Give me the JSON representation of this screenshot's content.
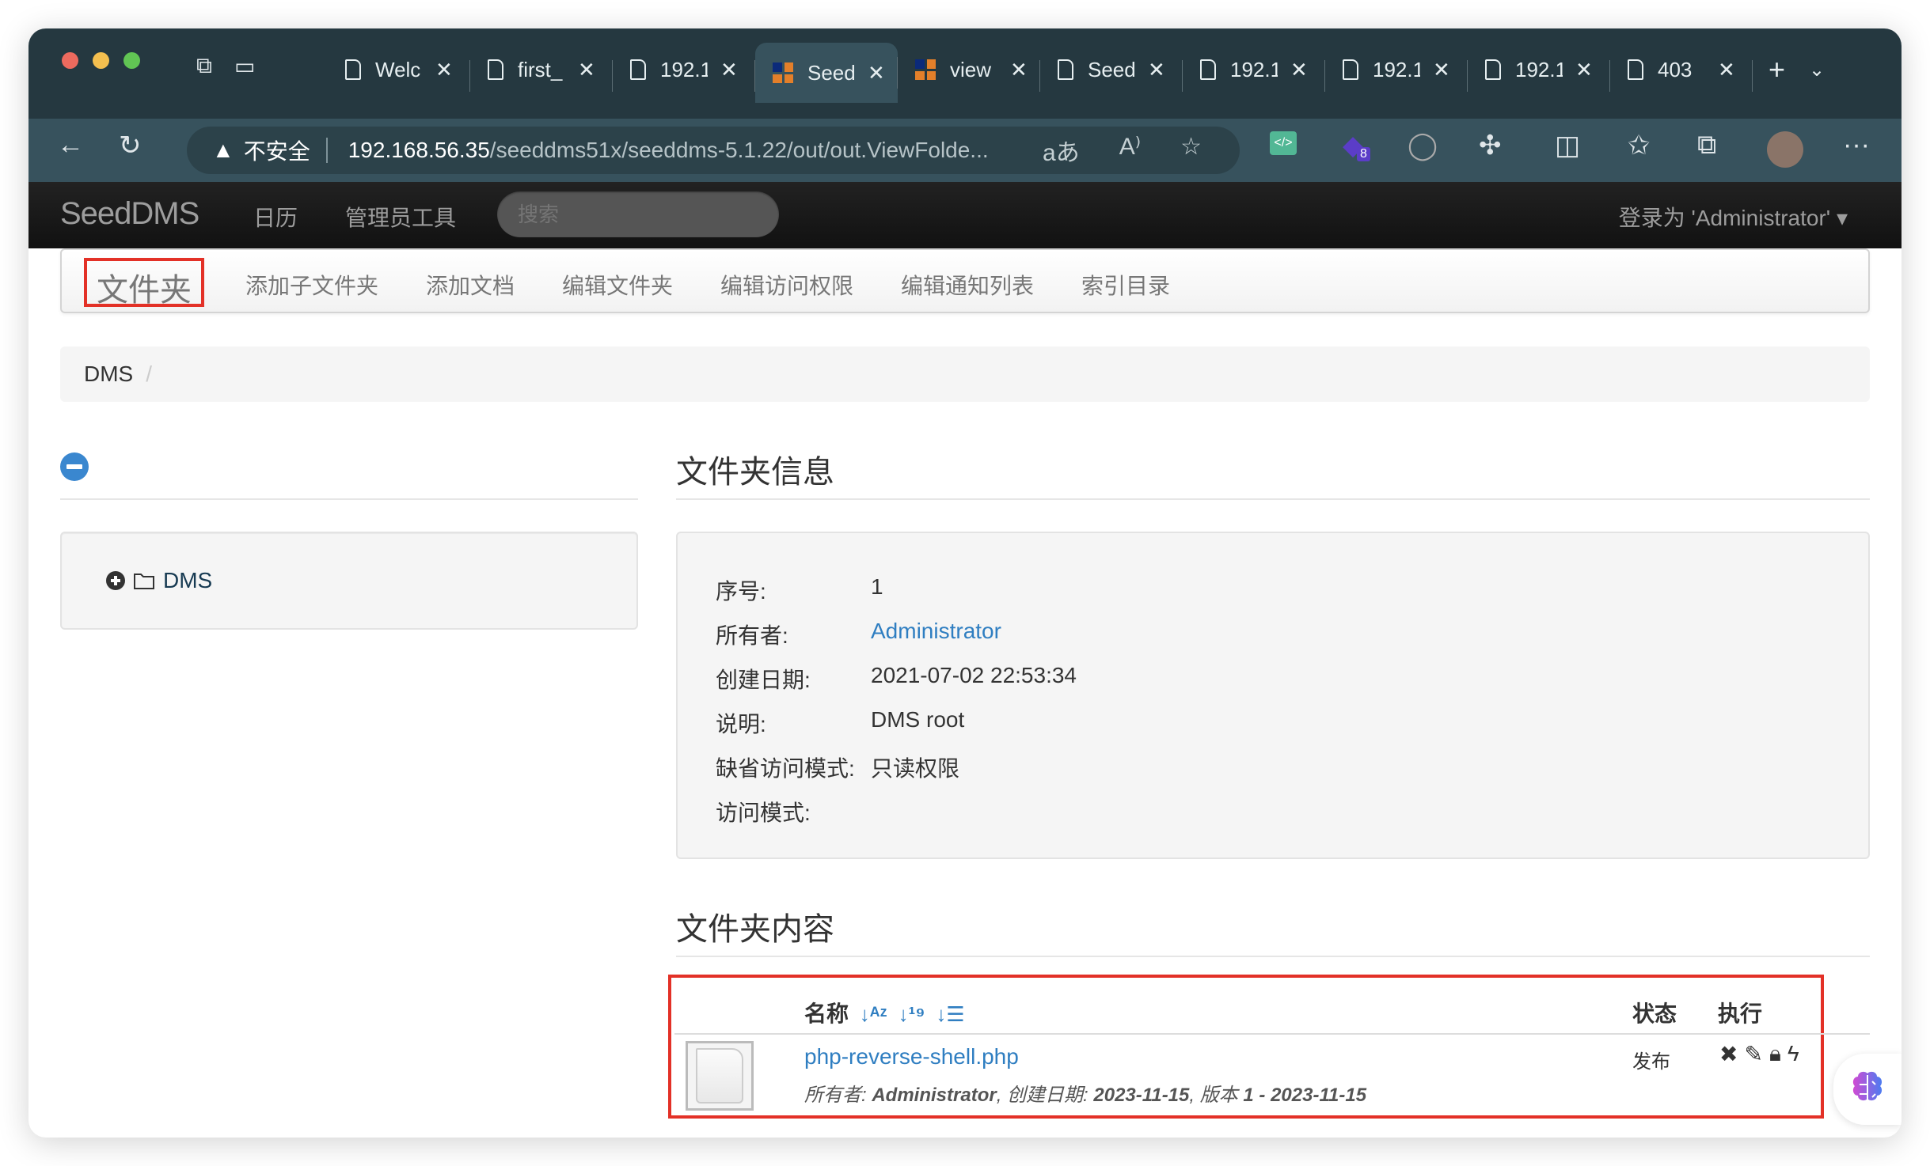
{
  "browser": {
    "tabs": [
      {
        "title": "Welc",
        "icon": "page-icon",
        "active": false
      },
      {
        "title": "first_",
        "icon": "page-icon",
        "active": false
      },
      {
        "title": "192.1",
        "icon": "page-icon",
        "active": false
      },
      {
        "title": "Seed",
        "icon": "seeddms-icon",
        "active": true
      },
      {
        "title": "view",
        "icon": "seeddms-icon",
        "active": false
      },
      {
        "title": "Seed",
        "icon": "page-icon",
        "active": false
      },
      {
        "title": "192.1",
        "icon": "page-icon",
        "active": false
      },
      {
        "title": "192.1",
        "icon": "page-icon",
        "active": false
      },
      {
        "title": "192.1",
        "icon": "page-icon",
        "active": false
      },
      {
        "title": "403",
        "icon": "page-icon",
        "active": false
      }
    ],
    "tab_close": "✕",
    "new_tab": "+",
    "tab_menu": "⌄",
    "address": {
      "security_label": "不安全",
      "host": "192.168.56.35",
      "path": "/seeddms51x/seeddms-5.1.22/out/out.ViewFolde..."
    },
    "extension_badge": "8",
    "more": "···"
  },
  "navbar": {
    "brand": "SeedDMS",
    "links": [
      "日历",
      "管理员工具"
    ],
    "search_placeholder": "搜索",
    "login": "登录为 'Administrator'"
  },
  "subnav": {
    "active": "文件夹",
    "items": [
      "添加子文件夹",
      "添加文档",
      "编辑文件夹",
      "编辑访问权限",
      "编辑通知列表",
      "索引目录"
    ]
  },
  "breadcrumb": {
    "items": [
      "DMS"
    ],
    "divider": "/"
  },
  "tree": {
    "root": "DMS"
  },
  "folder_info": {
    "title": "文件夹信息",
    "rows": [
      {
        "label": "序号:",
        "value": "1"
      },
      {
        "label": "所有者:",
        "value": "Administrator"
      },
      {
        "label": "创建日期:",
        "value": "2021-07-02 22:53:34"
      },
      {
        "label": "说明:",
        "value": "DMS root"
      },
      {
        "label": "缺省访问模式:",
        "value": "只读权限"
      },
      {
        "label": "访问模式:",
        "value": ""
      }
    ]
  },
  "folder_content": {
    "title": "文件夹内容",
    "columns": {
      "name": "名称",
      "status": "状态",
      "action": "执行"
    },
    "documents": [
      {
        "name": "php-reverse-shell.php",
        "owner_label": "所有者:",
        "owner": "Administrator",
        "created_label": "创建日期:",
        "created": "2023-11-15",
        "version_label": "版本",
        "version": "1 - 2023-11-15",
        "status": "发布"
      }
    ]
  },
  "colors": {
    "link": "#2f7ec1",
    "highlight": "#e33127",
    "navbar": "#1b1b1b",
    "chrome": "#253840"
  }
}
